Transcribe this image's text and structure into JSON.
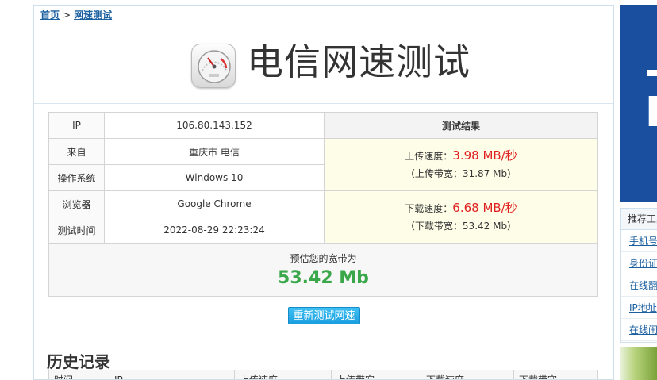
{
  "breadcrumb": {
    "home": "首页",
    "sep": ">",
    "current": "网速测试"
  },
  "title": "电信网速测试",
  "result_table": {
    "rows": [
      {
        "label": "IP",
        "value": "106.80.143.152"
      },
      {
        "label": "来自",
        "value": "重庆市 电信"
      },
      {
        "label": "操作系统",
        "value": "Windows 10"
      },
      {
        "label": "浏览器",
        "value": "Google Chrome"
      },
      {
        "label": "测试时间",
        "value": "2022-08-29 22:23:24"
      }
    ],
    "result_header": "测试结果",
    "upload": {
      "label": "上传速度：",
      "speed": "3.98 MB/秒",
      "bandwidth": "（上传带宽：31.87 Mb）"
    },
    "download": {
      "label": "下载速度：",
      "speed": "6.68 MB/秒",
      "bandwidth": "（下载带宽：53.42 Mb）"
    },
    "estimate": {
      "label": "预估您的宽带为",
      "value": "53.42 Mb"
    }
  },
  "retest_button": "重新测试网速",
  "history": {
    "title": "历史记录",
    "columns": [
      "时间",
      "IP",
      "上传速度",
      "上传带宽",
      "下载速度",
      "下载带宽"
    ]
  },
  "sidebar": {
    "panel_title": "推荐工具",
    "items": [
      "手机号",
      "身份证",
      "在线翻",
      "IP地址",
      "在线闹"
    ]
  },
  "colors": {
    "speed_red": "#e02020",
    "estimate_green": "#3aa84a",
    "button_blue": "#1a9ee0",
    "link_blue": "#1a5fa0"
  },
  "icons": {
    "logo": "speedometer-icon"
  }
}
